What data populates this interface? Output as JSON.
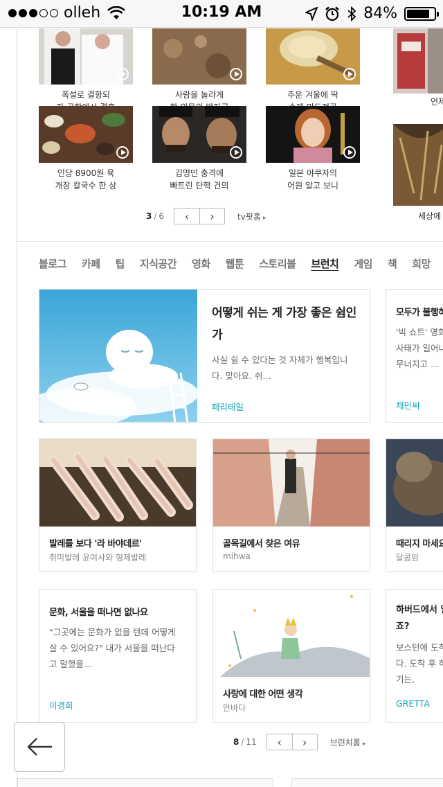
{
  "status_bar": {
    "carrier": "olleh",
    "time": "10:19 AM",
    "battery_percent": "84%",
    "battery_level": 0.84,
    "signal_bars_filled": 3,
    "signal_bars_total": 5
  },
  "tv_videos": [
    {
      "line1": "폭설로 결항되",
      "line2": "자 공항에서 결혼"
    },
    {
      "line1": "사람을 놀라게",
      "line2": "한 의문의 발자국"
    },
    {
      "line1": "추운 겨울에 딱",
      "line2": "수제 만두전골"
    },
    {
      "line1": "언제",
      "line2": ""
    },
    {
      "line1": "인당 8900원 육",
      "line2": "개장 칼국수 한 상"
    },
    {
      "line1": "김명민 충격에",
      "line2": "빠트린 탄핵 건의"
    },
    {
      "line1": "일본 야쿠자의",
      "line2": "어원 알고 보니"
    },
    {
      "line1": "세상에",
      "line2": ""
    }
  ],
  "tv_pager": {
    "current": "3",
    "total": "6",
    "prev": "‹",
    "next": "›",
    "link": "tv팟홈",
    "link_arrow": "▸"
  },
  "tabs": [
    "블로그",
    "카페",
    "팁",
    "지식공간",
    "영화",
    "웹툰",
    "스토리볼",
    "브런치",
    "게임",
    "책",
    "희망"
  ],
  "active_tab": "브런치",
  "featured": {
    "title_line1": "어떻게 쉬는 게 가장 좋은 쉼인",
    "title_line2": "가",
    "body_line1": "사실 쉴 수 있다는 것 자체가 행복입니",
    "body_line2": "다. 맞아요. 쉬…",
    "author": "페리테일"
  },
  "side_featured": {
    "title": "모두가 불행하",
    "body_line1": "'빅 쇼트' 영화",
    "body_line2": "사태가 일어나",
    "body_line3": "무너지고 …",
    "author": "채민씨"
  },
  "row2": [
    {
      "title": "발레를 보다 '라 바야데르'",
      "sub": "취미발레 윤여사와 형제발레"
    },
    {
      "title": "골목길에서 찾은 여유",
      "sub": "mihwa"
    },
    {
      "title": "때리지 마세요",
      "sub": "달콤맘"
    }
  ],
  "row3": {
    "text_card": {
      "title": "문화, 서울을 떠나면 없나요",
      "body_line1": "\"그곳에는 문화가 없을 텐데 어떻게",
      "body_line2": "살 수 있어요?\" 내가 서울을 떠난다",
      "body_line3": "고 말했을…",
      "author": "이경희"
    },
    "image_card": {
      "title": "사랑에 대한 어떤 생각",
      "sub": "안바다"
    },
    "side_card": {
      "title_line1": "하버드에서 일",
      "title_line2": "죠?",
      "body_line1": "보스턴에 도착",
      "body_line2": "다. 도착 후 하",
      "body_line3": "기는,",
      "author": "GRETTA"
    }
  },
  "brunch_pager": {
    "current": "8",
    "total": "11",
    "prev": "‹",
    "next": "›",
    "link": "브런치홈",
    "link_arrow": "▸"
  },
  "colors": {
    "accent": "#12a4b5",
    "text": "#222222",
    "muted": "#888888",
    "border": "#dcdcdc"
  }
}
